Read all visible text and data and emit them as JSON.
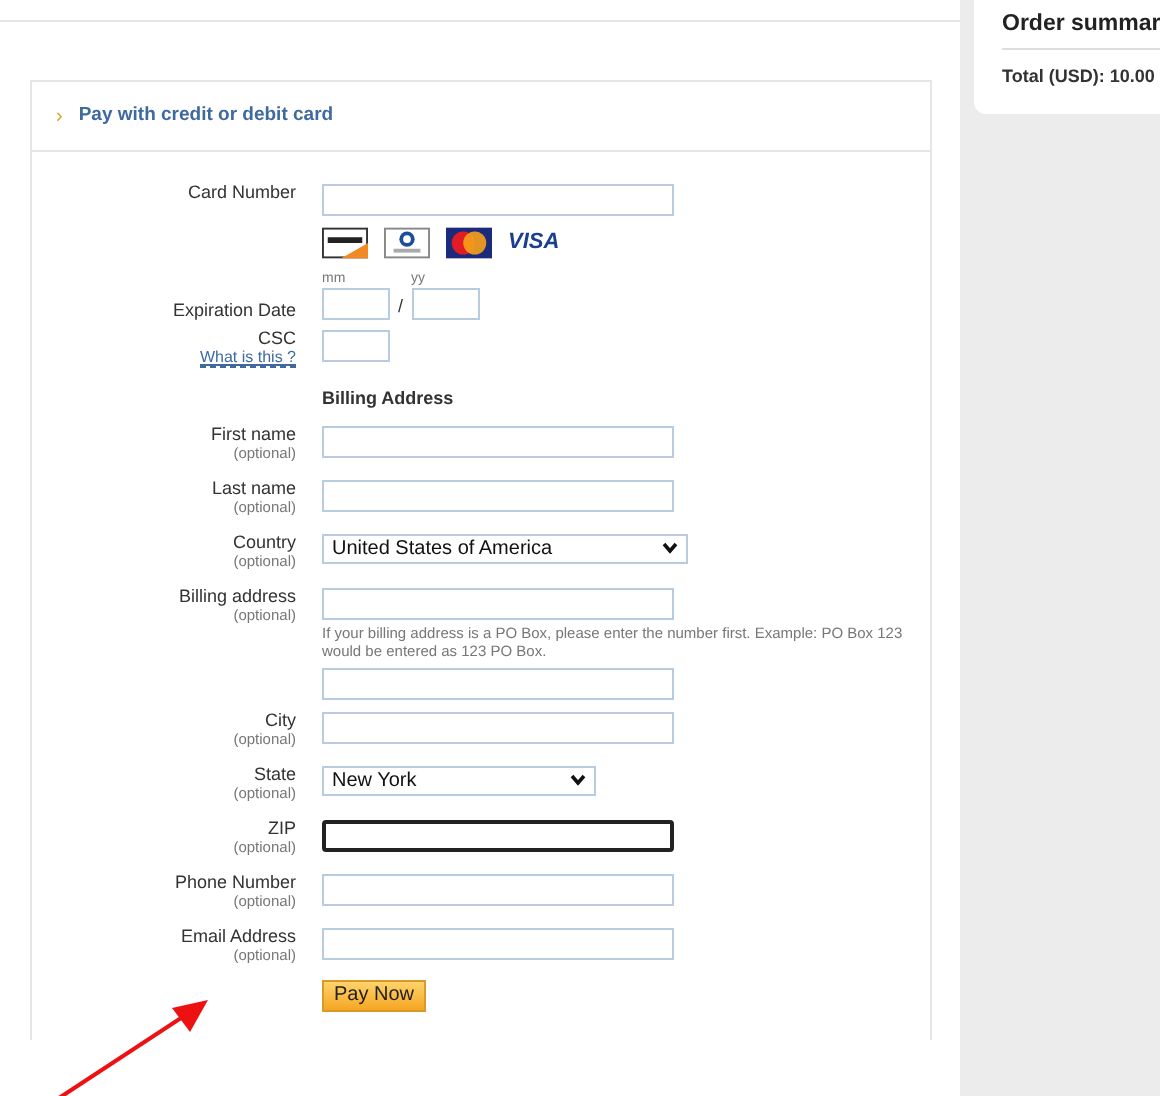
{
  "summary": {
    "title": "Order summar",
    "total": "Total (USD): 10.00"
  },
  "panel": {
    "chevron": "›",
    "title": "Pay with credit or debit card"
  },
  "card_number": {
    "label": "Card Number",
    "logos": [
      {
        "kind": "discover"
      },
      {
        "kind": "diners"
      },
      {
        "kind": "mastercard"
      },
      {
        "kind": "visa",
        "text": "VISA"
      }
    ]
  },
  "expiration": {
    "label": "Expiration Date",
    "month_caption": "mm",
    "year_caption": "yy",
    "separator": "/"
  },
  "csc": {
    "label": "CSC",
    "link": "What is this ?"
  },
  "billing_heading": "Billing Address",
  "fields": [
    {
      "kind": "text",
      "label": "First name",
      "note": "(optional)",
      "focused": false
    },
    {
      "kind": "text",
      "label": "Last name",
      "note": "(optional)",
      "focused": false
    },
    {
      "kind": "select",
      "label": "Country",
      "note": "(optional)",
      "value": "United States of America"
    },
    {
      "kind": "text",
      "label": "Billing address",
      "note": "(optional)",
      "hint": "If your billing address is a PO Box, please enter the number first. Example: PO Box 123 would be entered as 123 PO Box.",
      "focused": false
    },
    {
      "kind": "text",
      "focused": false
    },
    {
      "kind": "text",
      "label": "City",
      "note": "(optional)",
      "focused": false
    },
    {
      "kind": "select",
      "label": "State",
      "note": "(optional)",
      "value": "New York"
    },
    {
      "kind": "text",
      "label": "ZIP",
      "note": "(optional)",
      "focused": true
    },
    {
      "kind": "text",
      "label": "Phone Number",
      "note": "(optional)",
      "focused": false
    },
    {
      "kind": "text",
      "label": "Email Address",
      "note": "(optional)",
      "focused": false
    }
  ],
  "submit": "Pay Now",
  "annotation": {
    "kind": "arrow",
    "color": "#ee1111"
  }
}
